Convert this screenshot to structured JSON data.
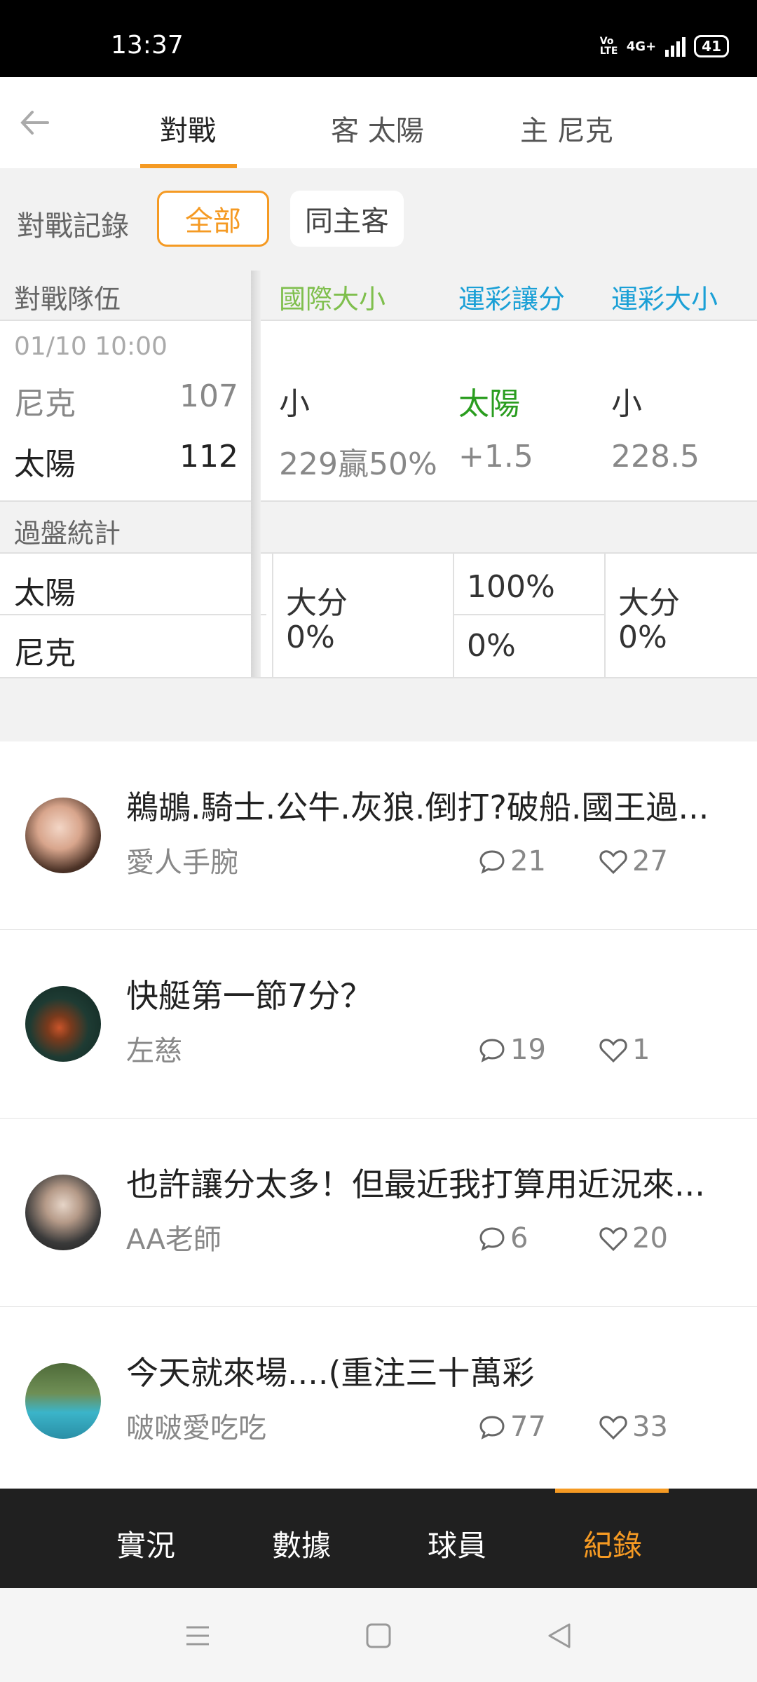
{
  "status": {
    "time": "13:37",
    "volte": "Vo LTE",
    "network": "4G+",
    "battery": "41"
  },
  "header": {
    "tabs": [
      "對戰",
      "客 太陽",
      "主 尼克"
    ],
    "active_tab": 0
  },
  "filter": {
    "label": "對戰記錄",
    "options": [
      "全部",
      "同主客"
    ],
    "selected": 0
  },
  "table": {
    "columns": {
      "team": "對戰隊伍",
      "intl_total": "國際大小",
      "spread": "運彩讓分",
      "lottery_total": "運彩大小"
    },
    "match": {
      "datetime": "01/10 10:00",
      "rows": [
        {
          "team": "尼克",
          "score": "107",
          "intl": "小",
          "spread": "太陽",
          "total": "小"
        },
        {
          "team": "太陽",
          "score": "112",
          "intl": "229贏50%",
          "spread": "+1.5",
          "total": "228.5"
        }
      ]
    },
    "stats": {
      "label": "過盤統計",
      "teams": [
        "太陽",
        "尼克"
      ],
      "intl": {
        "label": "大分",
        "value": "0%"
      },
      "spread": {
        "top": "100%",
        "bottom": "0%"
      },
      "total": {
        "label": "大分",
        "value": "0%"
      }
    }
  },
  "posts": [
    {
      "title": "鵜鶘.騎士.公牛.灰狼.倒打?破船.國王過...",
      "author": "愛人手腕",
      "comments": "21",
      "likes": "27"
    },
    {
      "title": "快艇第一節7分？",
      "author": "左慈",
      "comments": "19",
      "likes": "1"
    },
    {
      "title": "也許讓分太多！但最近我打算用近況來...",
      "author": "AA老師",
      "comments": "6",
      "likes": "20"
    },
    {
      "title": "今天就來場....(重注三十萬彩",
      "author": "啵啵愛吃吃",
      "comments": "77",
      "likes": "33"
    }
  ],
  "bottom_tabs": [
    "實況",
    "數據",
    "球員",
    "紀錄"
  ],
  "bottom_active": 3,
  "colors": {
    "accent": "#f59a23",
    "green": "#7fbf4d",
    "blue": "#1ba0d6",
    "team_green": "#2a9d1f"
  }
}
